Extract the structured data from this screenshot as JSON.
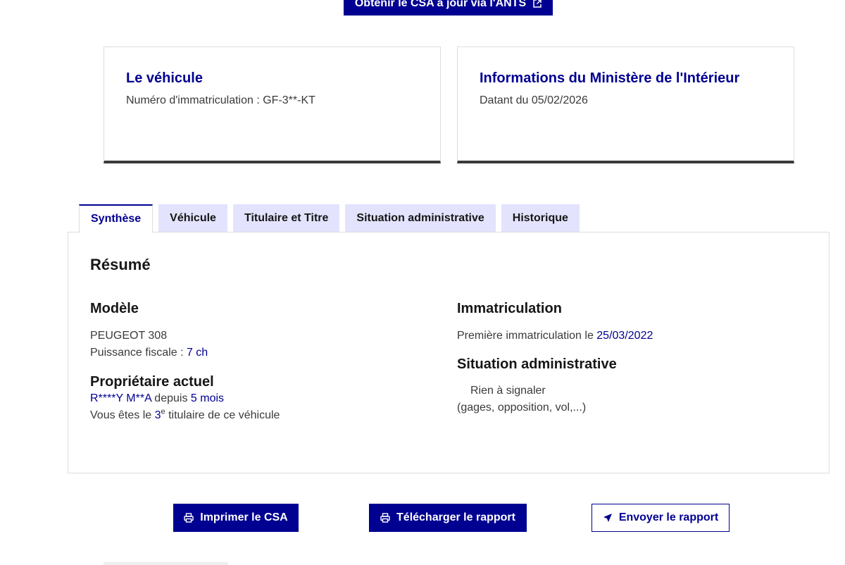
{
  "top_button": {
    "label": "Obtenir le CSA à jour via l'ANTS",
    "icon": "external-link-icon"
  },
  "cards": {
    "vehicle": {
      "title": "Le véhicule",
      "text": "Numéro d'immatriculation : GF-3**-KT"
    },
    "ministry": {
      "title": "Informations du Ministère de l'Intérieur",
      "text": "Datant du 05/02/2026"
    }
  },
  "tabs": [
    {
      "label": "Synthèse",
      "active": true
    },
    {
      "label": "Véhicule",
      "active": false
    },
    {
      "label": "Titulaire et Titre",
      "active": false
    },
    {
      "label": "Situation administrative",
      "active": false
    },
    {
      "label": "Historique",
      "active": false
    }
  ],
  "summary": {
    "title": "Résumé",
    "model": {
      "heading": "Modèle",
      "name": "PEUGEOT 308",
      "power_label": "Puissance fiscale : ",
      "power_value": "7 ch"
    },
    "owner": {
      "heading": "Propriétaire actuel",
      "name": "R****Y M**A",
      "since_label": " depuis ",
      "since_value": "5 mois",
      "rank_prefix": "Vous êtes le ",
      "rank_number": "3",
      "rank_sup": "e",
      "rank_suffix": " titulaire de ce véhicule"
    },
    "registration": {
      "heading": "Immatriculation",
      "label": "Première immatriculation le ",
      "date": "25/03/2022"
    },
    "admin": {
      "heading": "Situation administrative",
      "status": "Rien à signaler",
      "note": "(gages, opposition, vol,...)"
    }
  },
  "actions": {
    "print": {
      "label": "Imprimer le CSA",
      "icon": "printer-icon"
    },
    "download": {
      "label": "Télécharger le rapport",
      "icon": "printer-icon"
    },
    "send": {
      "label": "Envoyer le rapport",
      "icon": "send-icon"
    }
  },
  "colors": {
    "primary": "#000091",
    "tab_bg": "#e3e3fd",
    "border": "#dddddd"
  }
}
